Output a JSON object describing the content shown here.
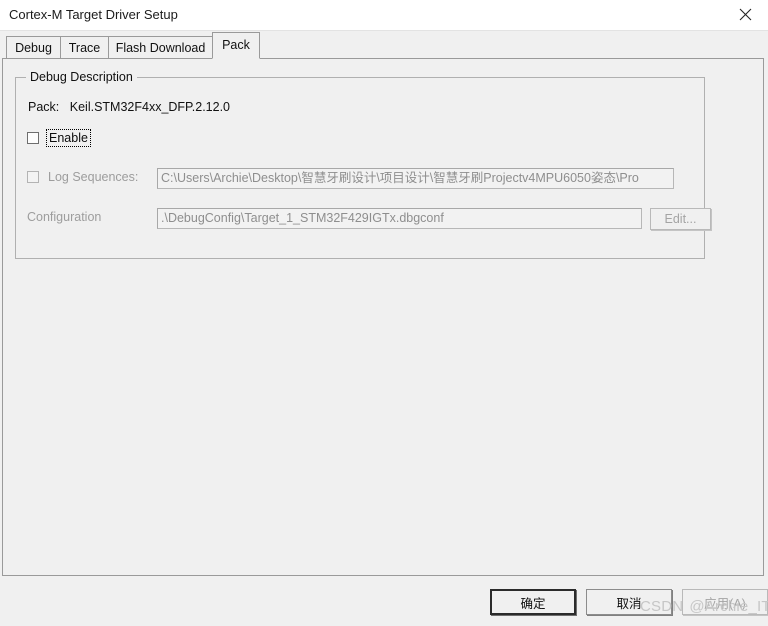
{
  "window": {
    "title": "Cortex-M Target Driver Setup",
    "close_icon": "close-icon",
    "close_glyph": "✕"
  },
  "tabs": [
    {
      "label": "Debug",
      "selected": false
    },
    {
      "label": "Trace",
      "selected": false
    },
    {
      "label": "Flash Download",
      "selected": false
    },
    {
      "label": "Pack",
      "selected": true
    }
  ],
  "debug_description": {
    "group_title": "Debug Description",
    "pack_label": "Pack:",
    "pack_value": "Keil.STM32F4xx_DFP.2.12.0",
    "enable": {
      "label": "Enable",
      "checked": false,
      "focused": true
    },
    "log_sequences": {
      "label": "Log Sequences:",
      "checked": false,
      "disabled": true,
      "value": "C:\\Users\\Archie\\Desktop\\智慧牙刷设计\\项目设计\\智慧牙刷Projectv4MPU6050姿态\\Pro"
    },
    "configuration": {
      "label": "Configuration",
      "value": ".\\DebugConfig\\Target_1_STM32F429IGTx.dbgconf",
      "edit_label": "Edit...",
      "edit_disabled": true
    }
  },
  "footer": {
    "ok_label": "确定",
    "cancel_label": "取消",
    "apply_label": "应用(A)",
    "apply_disabled": true
  },
  "watermark": {
    "site": "CSDN",
    "user": "@Archie_IT"
  },
  "colors": {
    "window_bg": "#f0f0f0",
    "titlebar_bg": "#ffffff",
    "border": "#9a9a9a",
    "disabled_text": "#9d9d9d",
    "watermark": "#c6c6c6"
  }
}
